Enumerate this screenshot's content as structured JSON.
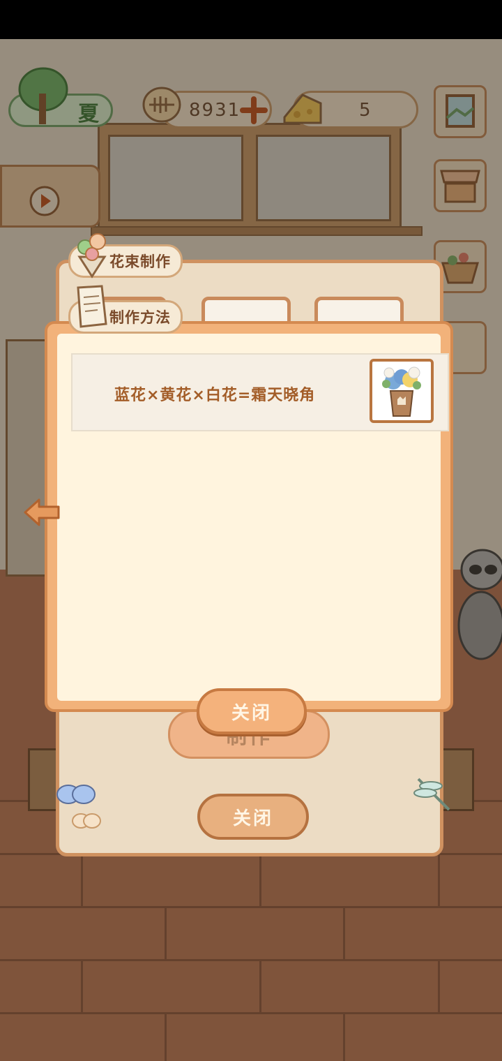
{
  "hud": {
    "season_label": "夏",
    "fish_currency": "8931",
    "cheese_currency": "5",
    "add_icon": "plus-icon"
  },
  "bouquet_panel": {
    "title": "花束制作",
    "make_label": "制作",
    "close_label": "关闭"
  },
  "recipe_popup": {
    "tab_label": "制作方法",
    "recipes": [
      {
        "formula": "蓝花×黄花×白花=霜天晓角",
        "image": "bouquet-icon"
      }
    ],
    "close_label": "关闭"
  },
  "colors": {
    "accent_orange": "#f2b27a",
    "text_brown": "#a35d28",
    "panel_border": "#d48a50"
  }
}
